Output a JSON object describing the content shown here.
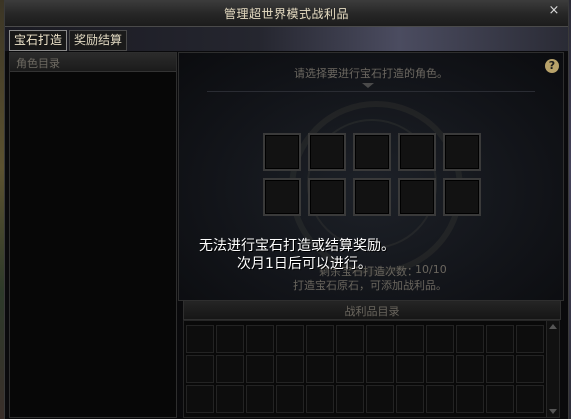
{
  "window": {
    "title": "管理超世界模式战利品",
    "close_symbol": "×"
  },
  "tabs": [
    {
      "label": "宝石打造",
      "active": true
    },
    {
      "label": "奖励结算",
      "active": false
    }
  ],
  "left_panel": {
    "header": "角色目录"
  },
  "right_panel": {
    "prompt": "请选择要进行宝石打造的角色。",
    "help_symbol": "?",
    "remaining_label": "剩余宝石打造次数：",
    "remaining_value": "10/10",
    "hint": "打造宝石原石，可添加战利品。"
  },
  "error": {
    "line1": "无法进行宝石打造或结算奖励。",
    "line2": "次月1日后可以进行。"
  },
  "loot": {
    "header": "战利品目录"
  },
  "colors": {
    "title_text": "#e6dcc2",
    "error_text": "#ffffff",
    "help_icon": "#b8a26a"
  }
}
